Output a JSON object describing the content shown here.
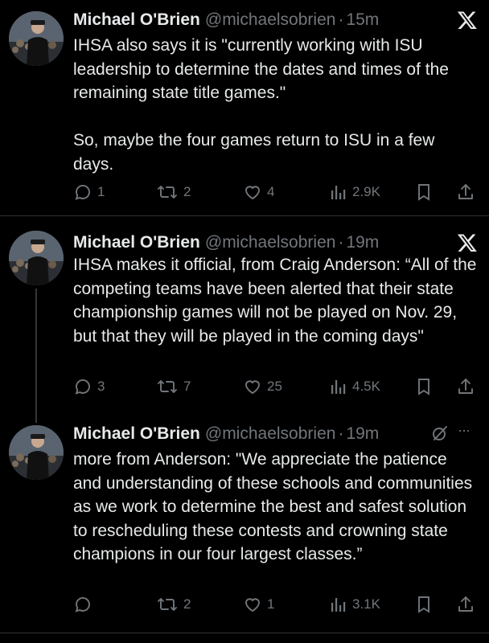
{
  "tweets": [
    {
      "name": "Michael O'Brien",
      "handle": "@michaelsobrien",
      "dot": "·",
      "time": "15m",
      "corner_icon": "x-logo-icon",
      "text": "IHSA also says it is \"currently working with ISU leadership to determine the dates and times of the remaining state title games.\"\n\nSo, maybe the four games return to ISU in a few days.",
      "replies": "1",
      "reposts": "2",
      "likes": "4",
      "views": "2.9K"
    },
    {
      "name": "Michael O'Brien",
      "handle": "@michaelsobrien",
      "dot": "·",
      "time": "19m",
      "corner_icon": "x-logo-icon",
      "text": "IHSA makes it official, from Craig Anderson: “All of the competing teams have been alerted that their state championship games will not be played on Nov. 29, but that they will be played in the coming days\"",
      "replies": "3",
      "reposts": "7",
      "likes": "25",
      "views": "4.5K"
    },
    {
      "name": "Michael O'Brien",
      "handle": "@michaelsobrien",
      "dot": "·",
      "time": "19m",
      "corner_icon": "grok-icon",
      "more": "···",
      "text": "more from Anderson: \"We appreciate the patience and understanding of these schools and communities as we work to determine the best and safest solution to rescheduling these contests and crowning state champions in our four largest classes.”",
      "replies": "",
      "reposts": "2",
      "likes": "1",
      "views": "3.1K"
    }
  ],
  "colors": {
    "background": "#000000",
    "text": "#e7e9ea",
    "muted": "#71767b",
    "divider": "#2f3336"
  }
}
